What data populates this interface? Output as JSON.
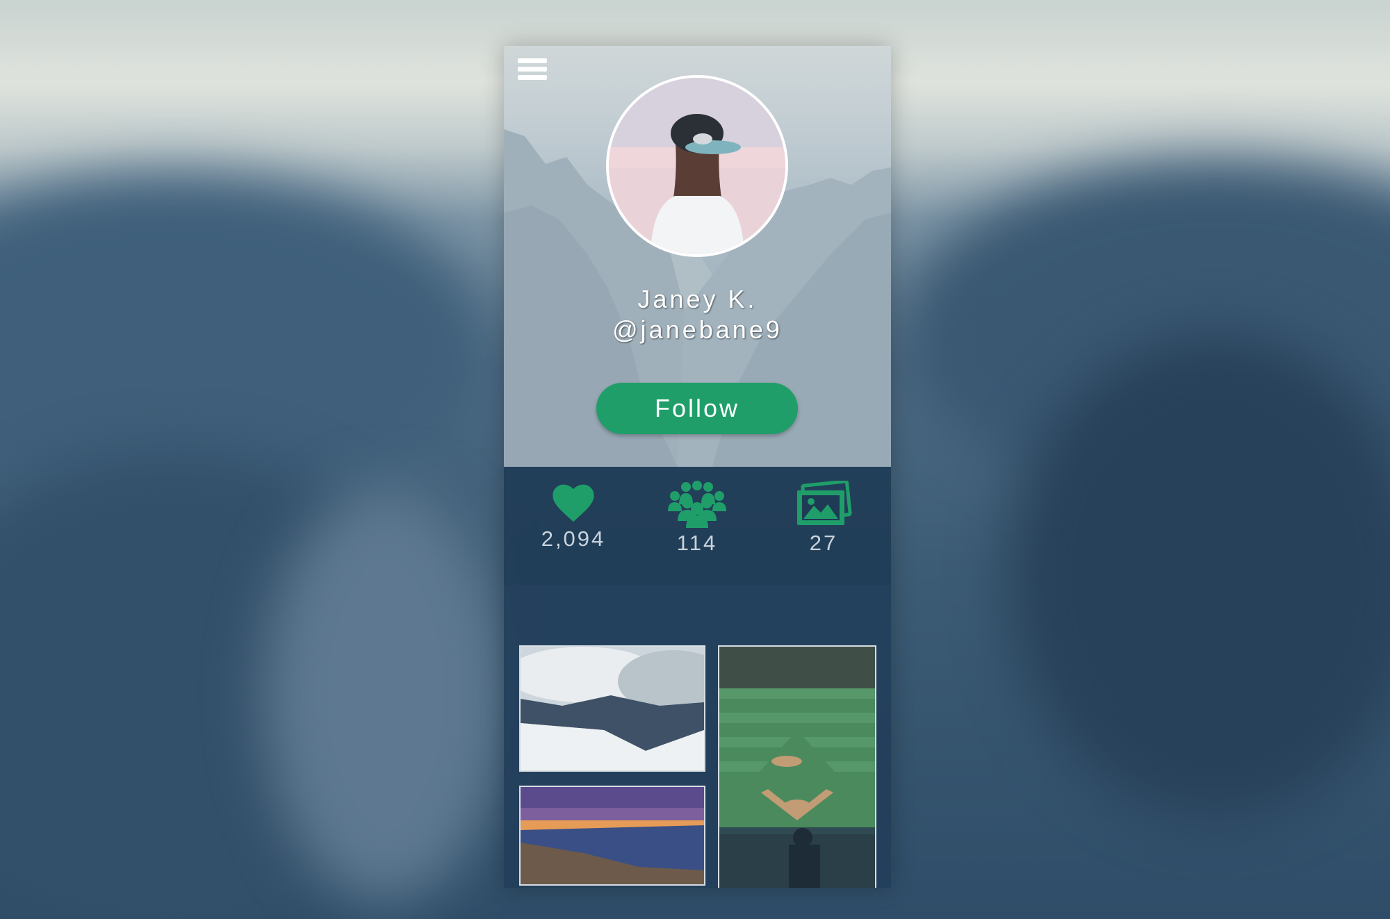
{
  "profile": {
    "name": "Janey K.",
    "handle": "@janebane9",
    "follow_label": "Follow"
  },
  "stats": {
    "likes": "2,094",
    "followers": "114",
    "photos": "27"
  },
  "icons": {
    "menu": "hamburger-menu-icon",
    "likes": "heart-icon",
    "followers": "group-icon",
    "photos": "photos-icon"
  },
  "colors": {
    "accent": "#1f9e6a",
    "panel": "#1e3a54",
    "text_light": "#ffffff"
  }
}
